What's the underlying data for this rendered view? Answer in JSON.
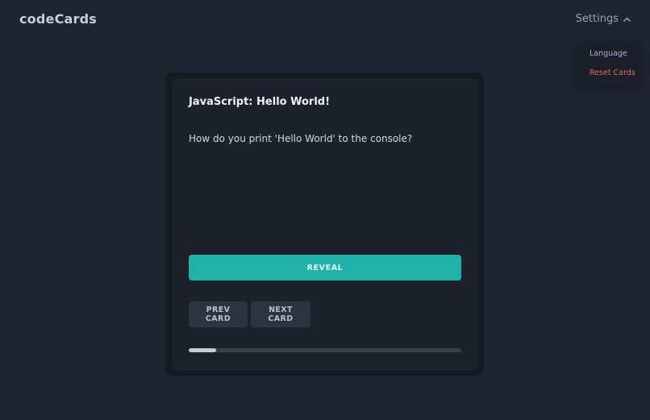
{
  "header": {
    "brand": "codeCards",
    "settings_label": "Settings"
  },
  "settings_menu": {
    "items": [
      {
        "label": "Language",
        "color": "#b7a6e6"
      },
      {
        "label": "Reset Cards",
        "color": "#e06b5a"
      }
    ]
  },
  "card": {
    "title": "JavaScript: Hello World!",
    "question": "How do you print 'Hello World' to the console?",
    "reveal_label": "REVEAL",
    "prev_label": "PREV CARD",
    "next_label": "NEXT CARD",
    "progress": 0.1
  },
  "colors": {
    "background": "#1e2430",
    "accent": "#20b2a6"
  },
  "icons": {
    "settings_toggle": "chevron-up-icon"
  }
}
